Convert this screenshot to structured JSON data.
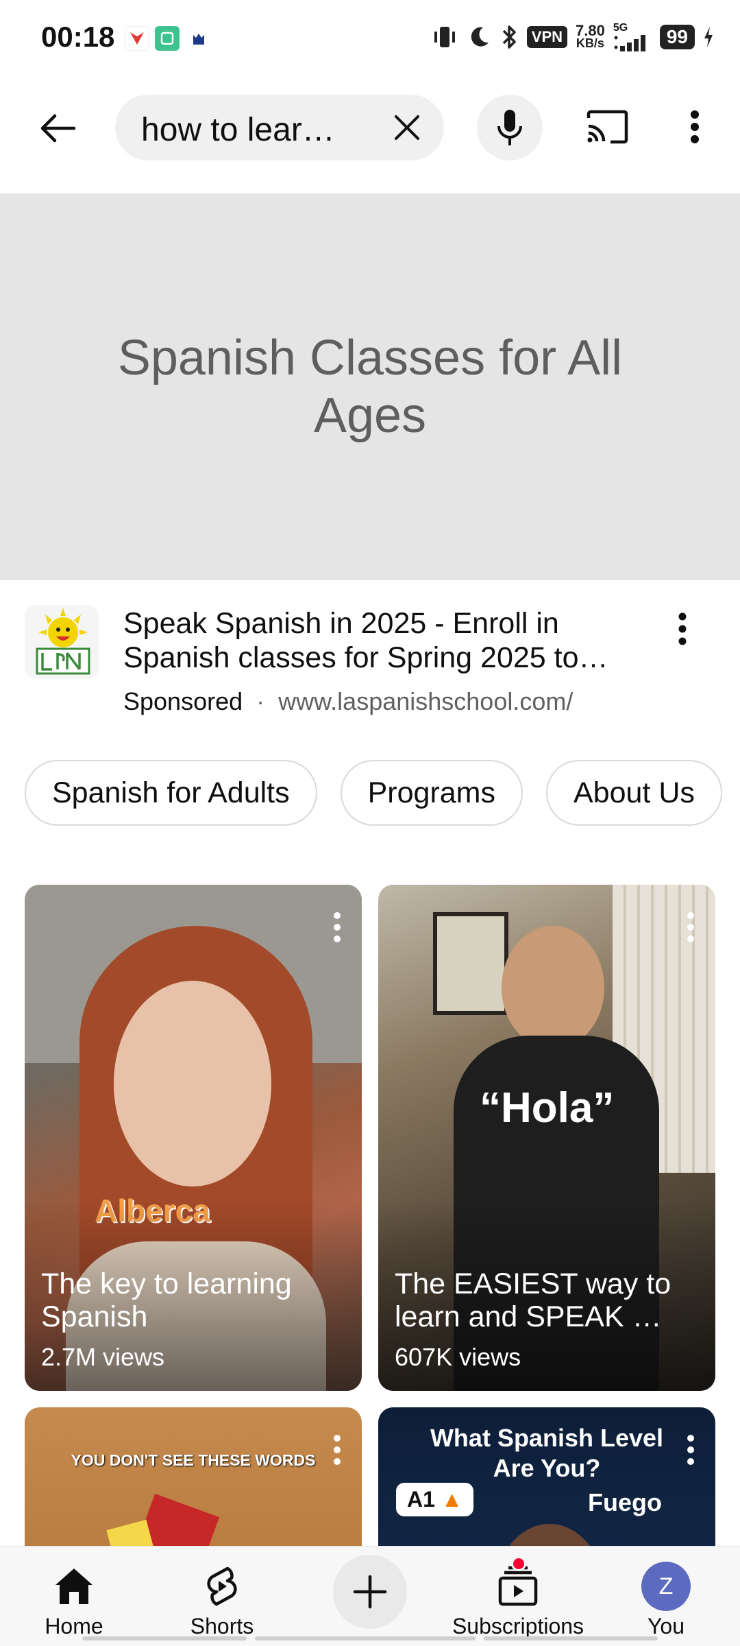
{
  "status_bar": {
    "time": "00:18",
    "vpn": "VPN",
    "speed_value": "7.80",
    "speed_unit": "KB/s",
    "network": "5G",
    "battery": "99"
  },
  "search": {
    "query": "how to lear…"
  },
  "ad": {
    "banner_title": "Spanish Classes for All Ages",
    "title_line1": "Speak Spanish in 2025 - Enroll in",
    "title_line2": "Spanish classes for Spring 2025 to…",
    "sponsored": "Sponsored",
    "separator": "·",
    "url": "www.laspanishschool.com/"
  },
  "chips": [
    {
      "label": "Spanish for Adults"
    },
    {
      "label": "Programs"
    },
    {
      "label": "About Us"
    }
  ],
  "videos": [
    {
      "title": "The key to learning Spanish",
      "views": "2.7M views",
      "overlay": "Alberca"
    },
    {
      "title": "The EASIEST way to learn and SPEAK …",
      "views": "607K views",
      "overlay": "“Hola”"
    },
    {
      "overlay": "YOU DON'T SEE THESE WORDS"
    },
    {
      "overlay_line1": "What Spanish Level",
      "overlay_line2": "Are You?",
      "level": "A1",
      "word": "Fuego"
    }
  ],
  "nav": {
    "home": "Home",
    "shorts": "Shorts",
    "subscriptions": "Subscriptions",
    "you": "You",
    "avatar_letter": "Z"
  },
  "colors": {
    "accent_red": "#ff0033",
    "avatar": "#5c6bc0",
    "chip_border": "#d9d9d9"
  }
}
